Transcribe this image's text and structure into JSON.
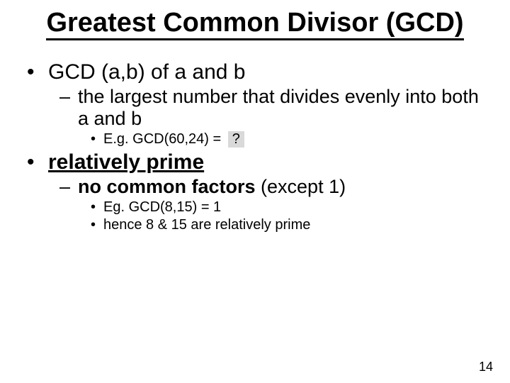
{
  "title": "Greatest Common Divisor (GCD)",
  "b1": {
    "text": "GCD (a,b) of a and b"
  },
  "b1_1": {
    "text": "the largest number that divides evenly into both a and b"
  },
  "b1_1_1": {
    "prefix": "E.g. GCD(60,24) = ",
    "box": "?"
  },
  "b2": {
    "text": "relatively prime"
  },
  "b2_1": {
    "prefix": "no common factors",
    "suffix": " (except 1)"
  },
  "b2_1_1": {
    "text": "Eg. GCD(8,15) = 1"
  },
  "b2_1_2": {
    "text": "hence 8 & 15 are relatively prime"
  },
  "page_number": "14"
}
